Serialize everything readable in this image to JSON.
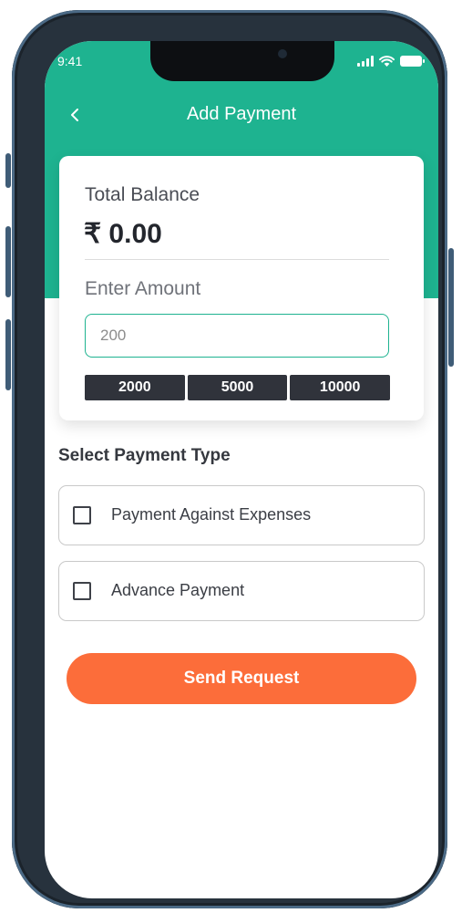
{
  "status_bar": {
    "time": "9:41",
    "icons": [
      "signal-icon",
      "wifi-icon",
      "battery-icon"
    ]
  },
  "header": {
    "title": "Add Payment",
    "back_icon": "chevron-left-icon"
  },
  "balance_card": {
    "balance_label": "Total Balance",
    "balance_value": "₹ 0.00",
    "amount_label": "Enter Amount",
    "amount_placeholder": "200",
    "amount_value": "",
    "quick_amounts": [
      "2000",
      "5000",
      "10000"
    ]
  },
  "payment_type": {
    "title": "Select Payment Type",
    "options": [
      {
        "label": "Payment Against Expenses",
        "checked": false
      },
      {
        "label": "Advance Payment",
        "checked": false
      }
    ]
  },
  "actions": {
    "send_label": "Send Request"
  },
  "colors": {
    "primary": "#1eb390",
    "accent": "#fc6d3a",
    "chip": "#30333b"
  }
}
